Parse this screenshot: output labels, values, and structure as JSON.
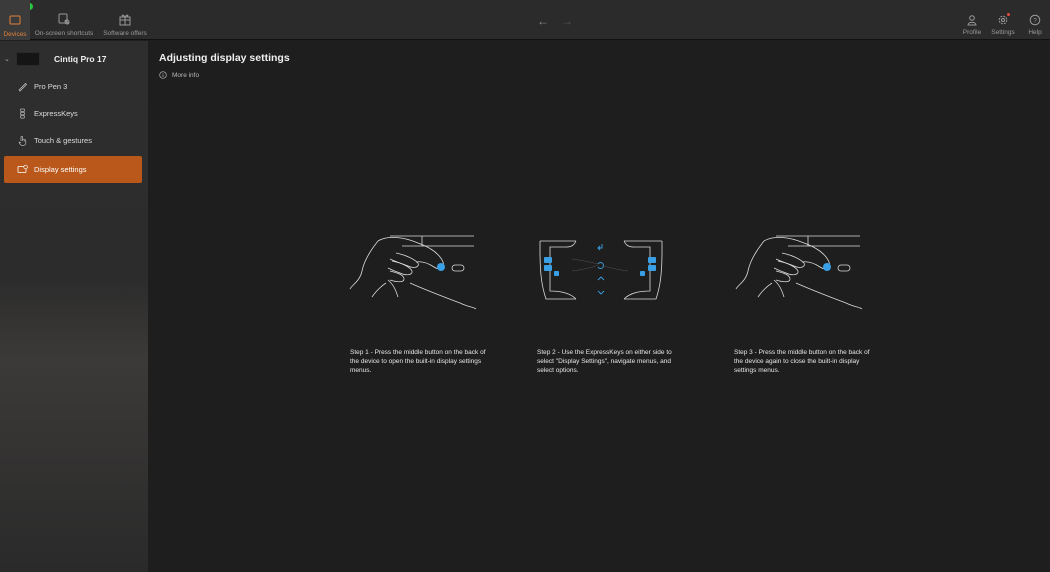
{
  "window": {
    "tabs": {
      "devices": "Devices",
      "shortcuts": "On-screen shortcuts",
      "offers": "Software offers"
    },
    "right": {
      "profile": "Profile",
      "settings": "Settings",
      "help": "Help"
    },
    "nav": {
      "back": "←",
      "forward": "→"
    },
    "accent": "#e0823a"
  },
  "sidebar": {
    "device_name": "Cintiq Pro 17",
    "items": [
      {
        "label": "Pro Pen 3",
        "icon": "pen-icon"
      },
      {
        "label": "ExpressKeys",
        "icon": "expresskeys-icon"
      },
      {
        "label": "Touch & gestures",
        "icon": "touch-icon"
      },
      {
        "label": "Display settings",
        "icon": "display-settings-icon",
        "selected": true
      }
    ],
    "selected_color": "#b9581a"
  },
  "main": {
    "title": "Adjusting display settings",
    "more_info": "More info",
    "steps": [
      {
        "text": "Step 1 - Press the middle button on the back of the device to open the built-in display settings menus."
      },
      {
        "text": "Step 2 - Use the ExpressKeys on either side to select \"Display Settings\", navigate menus, and select options."
      },
      {
        "text": "Step 3 - Press the middle button on the back of the device again to close the built-in display settings menus."
      }
    ]
  }
}
